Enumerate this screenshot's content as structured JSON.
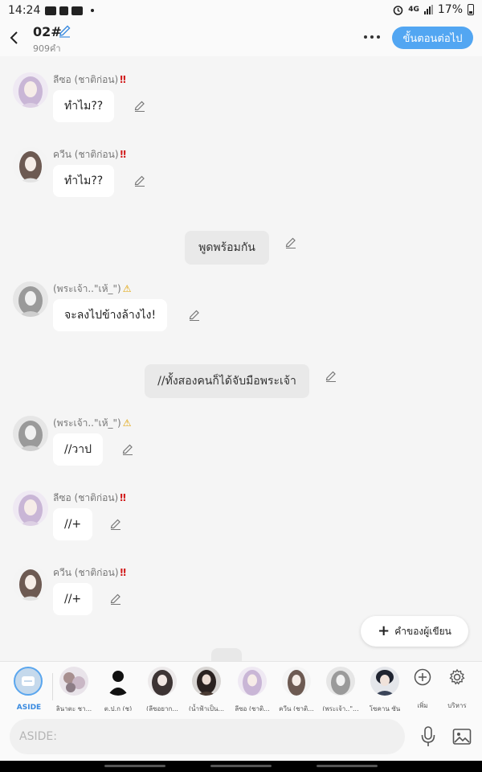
{
  "status_bar": {
    "time": "14:24",
    "network": "4G",
    "battery": "17%"
  },
  "header": {
    "title": "02#",
    "subtitle": "909คำ",
    "next_button": "ขั้นตอนต่อไป"
  },
  "colors": {
    "accent": "#52a6f2",
    "warning_mark": "#e0a100",
    "alert_mark": "#d11a1a"
  },
  "messages": [
    {
      "name": "ลีซอ (ชาติก่อน)",
      "mark": "‼",
      "text": "ทำไม??"
    },
    {
      "name": "ควีน (ชาติก่อน)",
      "mark": "‼",
      "text": "ทำไม??"
    },
    {
      "narration": "พูดพร้อมกัน"
    },
    {
      "name": "(พระเจ้า..\"เห้_\")",
      "mark": "⚠",
      "text": "จะลงไปข้างล้างไง!"
    },
    {
      "narration": "//ทั้งสองคนก็ได้จับมือพระเจ้า"
    },
    {
      "name": "(พระเจ้า..\"เห้_\")",
      "mark": "⚠",
      "text": "//วาป"
    },
    {
      "name": "ลีซอ (ชาติก่อน)",
      "mark": "‼",
      "text": "//+"
    },
    {
      "name": "ควีน (ชาติก่อน)",
      "mark": "‼",
      "text": "//+"
    }
  ],
  "writer_button": "คำของผู้เขียน",
  "cast_bar": {
    "aside_label": "ASIDE",
    "characters": [
      "ลินาตะ ชา...",
      "ต.ป.ก (ช)",
      "(ลีซอยาก...",
      "(น้ำฟ้าเป็น...",
      "ลีซอ (ชาติ...",
      "ควีน (ชาติ...",
      "(พระเจ้า..\"...",
      "โซคาน ซัน"
    ],
    "add_label": "เพิ่ม",
    "manage_label": "บริหาร"
  },
  "input": {
    "placeholder": "ASIDE:"
  }
}
